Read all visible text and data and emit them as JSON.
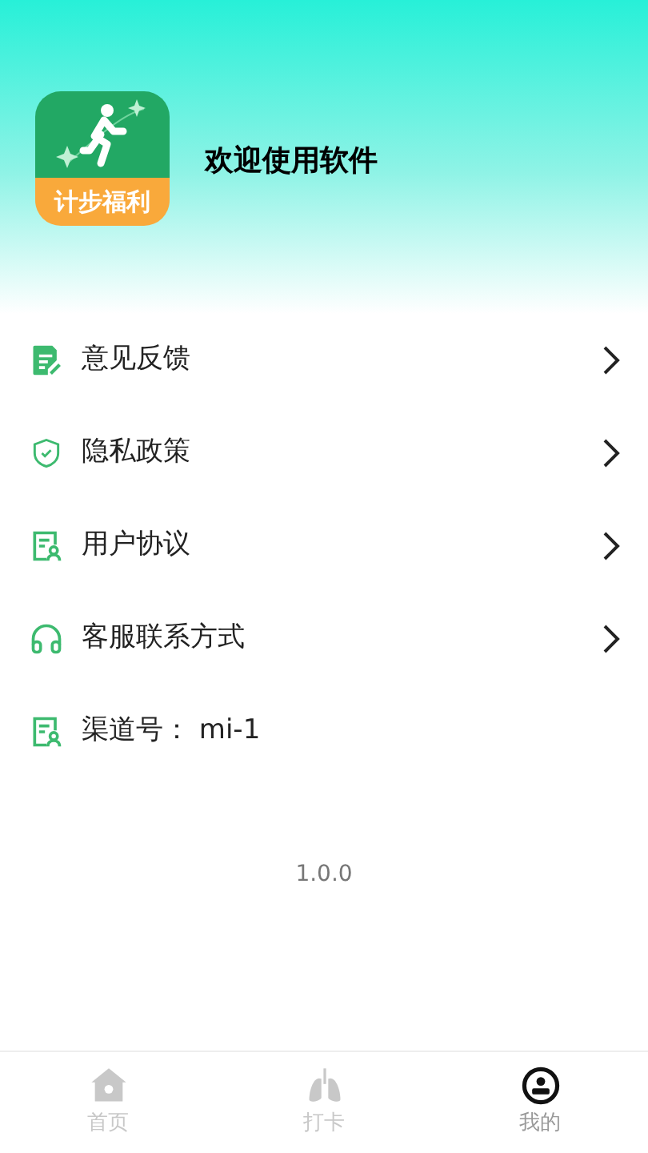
{
  "header": {
    "logo_text": "计步福利",
    "title": "欢迎使用软件"
  },
  "menu": [
    {
      "label": "意见反馈",
      "kind": "link"
    },
    {
      "label": "隐私政策",
      "kind": "link"
    },
    {
      "label": "用户协议",
      "kind": "link"
    },
    {
      "label": "客服联系方式",
      "kind": "link"
    },
    {
      "label": "渠道号： mi-1",
      "kind": "info"
    }
  ],
  "version": "1.0.0",
  "tabs": [
    {
      "label": "首页",
      "selected": false
    },
    {
      "label": "打卡",
      "selected": false
    },
    {
      "label": "我的",
      "selected": true
    }
  ]
}
